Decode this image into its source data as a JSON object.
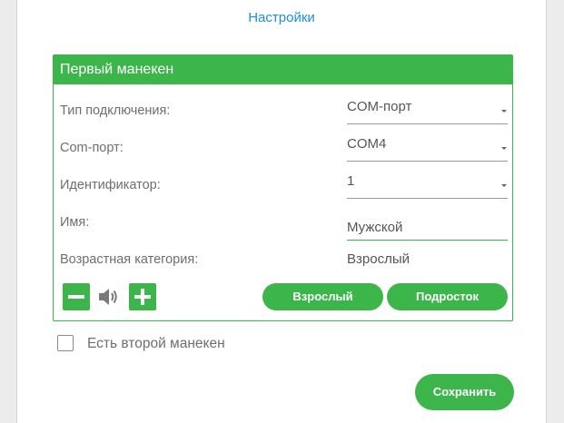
{
  "header": {
    "settings_link": "Настройки"
  },
  "panel": {
    "title": "Первый манекен",
    "connection_type": {
      "label": "Тип подключения:",
      "value": "COM-порт"
    },
    "com_port": {
      "label": "Com-порт:",
      "value": "COM4"
    },
    "identifier": {
      "label": "Идентификатор:",
      "value": "1"
    },
    "name": {
      "label": "Имя:",
      "value": "Мужской"
    },
    "age_category": {
      "label": "Возрастная категория:",
      "value": "Взрослый"
    },
    "controls": {
      "volume_down_icon": "minus-icon",
      "speaker_icon": "speaker-icon",
      "volume_up_icon": "plus-icon",
      "adult_button": "Взрослый",
      "teen_button": "Подросток"
    }
  },
  "second_mannequin": {
    "label": "Есть второй манекен",
    "checked": false
  },
  "footer": {
    "save_button": "Сохранить"
  },
  "colors": {
    "accent": "#3cb54a",
    "link": "#1a8fe0",
    "label_text": "#6e6e6e",
    "value_text": "#555555"
  }
}
